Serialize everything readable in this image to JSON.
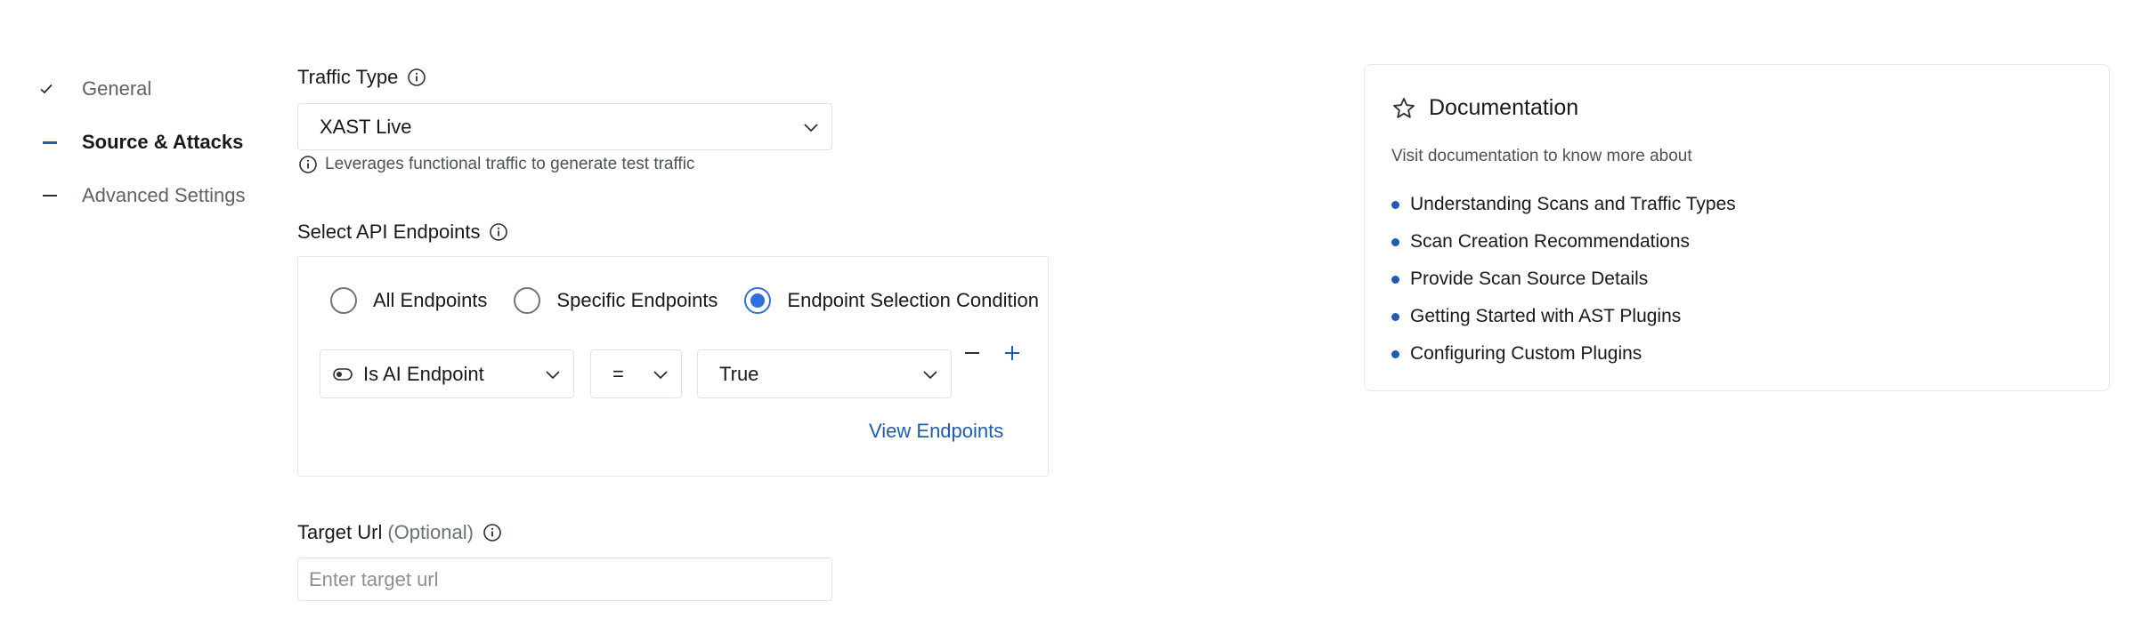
{
  "steps": [
    {
      "label": "General",
      "state": "done"
    },
    {
      "label": "Source & Attacks",
      "state": "active"
    },
    {
      "label": "Advanced Settings",
      "state": "pending"
    }
  ],
  "traffic_type": {
    "label": "Traffic Type",
    "value": "XAST Live",
    "hint": "Leverages functional traffic to generate test traffic"
  },
  "api_endpoints": {
    "label": "Select API Endpoints",
    "options": [
      "All Endpoints",
      "Specific Endpoints",
      "Endpoint Selection Condition"
    ],
    "selected": "Endpoint Selection Condition",
    "condition": {
      "field": "Is AI Endpoint",
      "operator": "=",
      "value": "True"
    },
    "view_link": "View Endpoints"
  },
  "target_url": {
    "label": "Target Url",
    "optional": "(Optional)",
    "placeholder": "Enter target url",
    "value": ""
  },
  "documentation": {
    "title": "Documentation",
    "subtitle": "Visit documentation to know more about",
    "links": [
      "Understanding Scans and Traffic Types",
      "Scan Creation Recommendations",
      "Provide Scan Source Details",
      "Getting Started with AST Plugins",
      "Configuring Custom Plugins"
    ]
  },
  "colors": {
    "accent": "#2f6fe0",
    "link": "#1b5db0",
    "border": "#dfe2e6"
  }
}
